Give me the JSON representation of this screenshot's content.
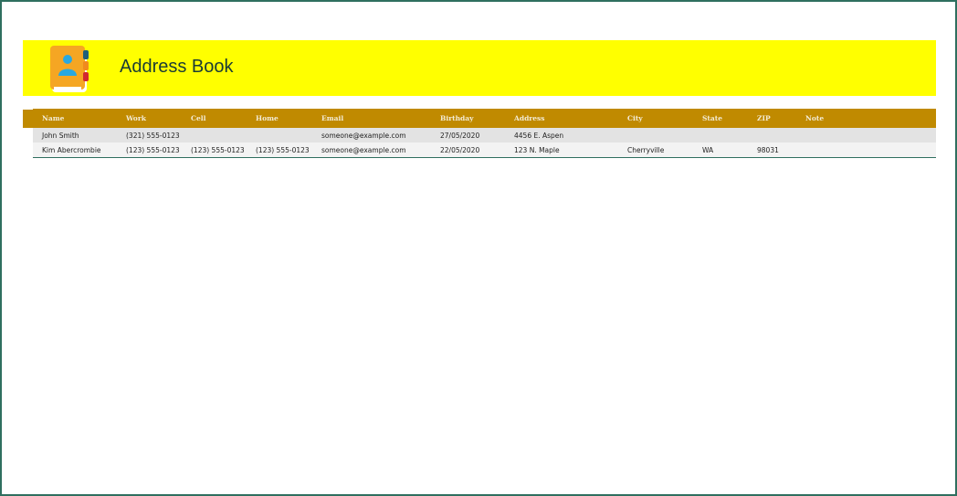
{
  "header": {
    "title": "Address Book",
    "icon": "address-book-icon",
    "banner_color": "#ffff00"
  },
  "table": {
    "header_color": "#c08a00",
    "columns": [
      "Name",
      "Work",
      "Cell",
      "Home",
      "Email",
      "Birthday",
      "Address",
      "City",
      "State",
      "ZIP",
      "Note"
    ],
    "rows": [
      [
        "John Smith",
        "(321) 555-0123",
        "",
        "",
        "someone@example.com",
        "27/05/2020",
        "4456 E. Aspen",
        "",
        "",
        "",
        ""
      ],
      [
        "Kim Abercrombie",
        "(123) 555-0123",
        "(123) 555-0123",
        "(123) 555-0123",
        "someone@example.com",
        "22/05/2020",
        "123 N. Maple",
        "Cherryville",
        "WA",
        "98031",
        ""
      ]
    ]
  }
}
